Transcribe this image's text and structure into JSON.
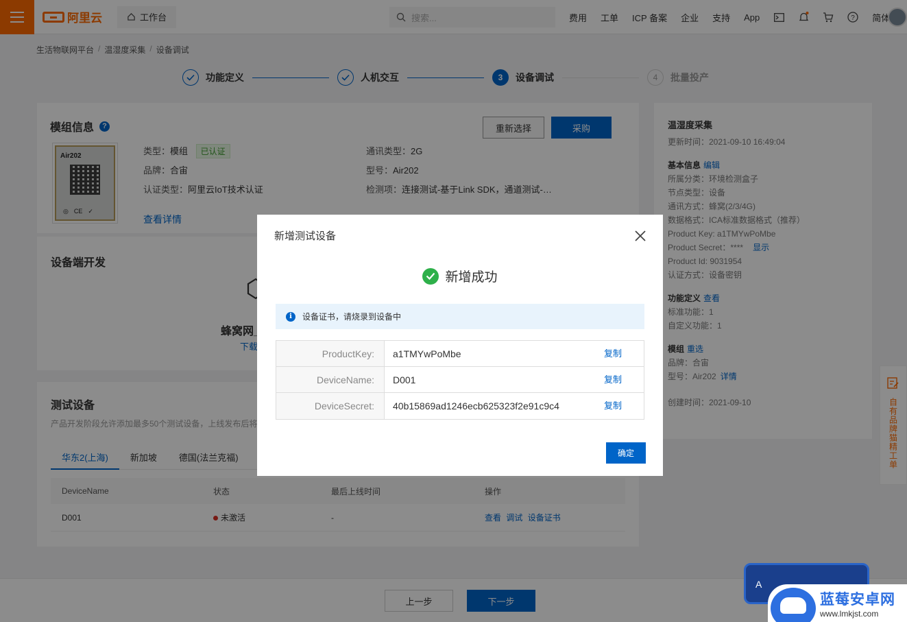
{
  "topbar": {
    "logo": "阿里云",
    "workbench": "工作台",
    "search_placeholder": "搜索...",
    "nav": [
      "费用",
      "工单",
      "ICP 备案",
      "企业",
      "支持",
      "App"
    ],
    "lang": "简体"
  },
  "breadcrumb": [
    "生活物联网平台",
    "温湿度采集",
    "设备调试"
  ],
  "steps": [
    {
      "label": "功能定义",
      "state": "done"
    },
    {
      "label": "人机交互",
      "state": "done"
    },
    {
      "label": "设备调试",
      "state": "active",
      "num": "3"
    },
    {
      "label": "批量投产",
      "state": "todo",
      "num": "4"
    }
  ],
  "module": {
    "title": "模组信息",
    "reselect": "重新选择",
    "purchase": "采购",
    "chip_label": "Air202",
    "type_label": "类型：",
    "type_value": "模组",
    "certified": "已认证",
    "brand_label": "品牌：",
    "brand_value": "合宙",
    "cert_label": "认证类型：",
    "cert_value": "阿里云IoT技术认证",
    "comm_label": "通讯类型：",
    "comm_value": "2G",
    "model_label": "型号：",
    "model_value": "Air202",
    "check_label": "检测项：",
    "check_value": "连接测试-基于Link SDK，通道测试-…",
    "details": "查看详情"
  },
  "device_dev": {
    "title": "设备端开发",
    "name_partial": "蜂窝网_",
    "link_partial": "下载"
  },
  "test_devices": {
    "title": "测试设备",
    "desc": "产品开发阶段允许添加最多50个测试设备，上线发布后将",
    "tabs": [
      "华东2(上海)",
      "新加坡",
      "德国(法兰克福)"
    ],
    "columns": [
      "DeviceName",
      "状态",
      "最后上线时间",
      "操作"
    ],
    "rows": [
      {
        "name": "D001",
        "status": "未激活",
        "last": "-",
        "ops": [
          "查看",
          "调试",
          "设备证书"
        ]
      }
    ]
  },
  "sidebar": {
    "title": "温湿度采集",
    "updated": "更新时间：2021-09-10 16:49:04",
    "basic_title": "基本信息",
    "edit": "编辑",
    "basic": [
      "所属分类：环境检测盒子",
      "节点类型：设备",
      "通讯方式：蜂窝(2/3/4G)",
      "数据格式：ICA标准数据格式（推荐）",
      "Product Key:  a1TMYwPoMbe"
    ],
    "secret_label": "Product Secret：****",
    "show": "显示",
    "product_id": "Product Id:  9031954",
    "auth": "认证方式：设备密钥",
    "func_title": "功能定义",
    "view": "查看",
    "func": [
      "标准功能：1",
      "自定义功能：1"
    ],
    "module_title": "模组",
    "reselect": "重选",
    "module_brand": "品牌：合宙",
    "module_model": "型号：Air202",
    "detail": "详情",
    "created": "创建时间：2021-09-10"
  },
  "float_tab": "自有品牌猫精工单",
  "bottom": {
    "prev": "上一步",
    "next": "下一步"
  },
  "modal": {
    "title": "新增测试设备",
    "success": "新增成功",
    "notice": "设备证书，请烧录到设备中",
    "rows": [
      {
        "key": "ProductKey:",
        "value": "a1TMYwPoMbe",
        "copy": "复制"
      },
      {
        "key": "DeviceName:",
        "value": "D001",
        "copy": "复制"
      },
      {
        "key": "DeviceSecret:",
        "value": "40b15869ad1246ecb625323f2e91c9c4",
        "copy": "复制"
      }
    ],
    "ok": "确定"
  },
  "watermark": {
    "title": "蓝莓安卓网",
    "url": "www.lmkjst.com",
    "banner_letter": "A"
  }
}
